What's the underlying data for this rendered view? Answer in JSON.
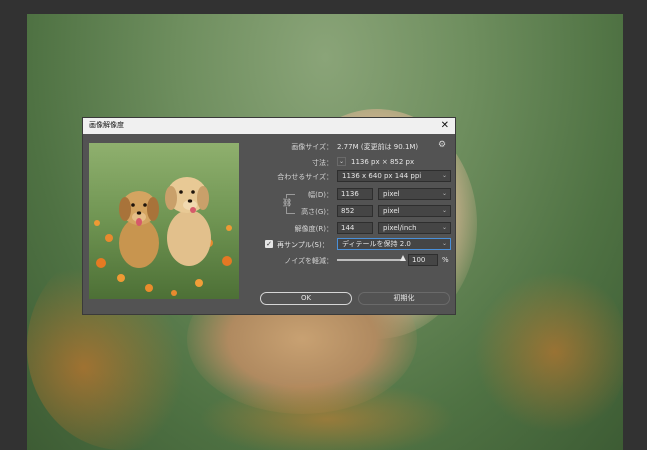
{
  "dialog": {
    "title": "画像解像度",
    "close_glyph": "✕",
    "image_size_label": "画像サイズ：",
    "image_size_value": "2.77M (変更前は 90.1M)",
    "dimensions_label": "寸法：",
    "dimensions_value": "1136 px × 852 px",
    "fit_label": "合わせるサイズ：",
    "fit_value": "1136 x 640 px 144 ppi",
    "width_label": "幅(D)：",
    "width_value": "1136",
    "width_unit": "pixel",
    "height_label": "高さ(G)：",
    "height_value": "852",
    "height_unit": "pixel",
    "resolution_label": "解像度(R)：",
    "resolution_value": "144",
    "resolution_unit": "pixel/inch",
    "resample_label": "再サンプル(S)：",
    "resample_value": "ディテールを保持 2.0",
    "resample_checked": true,
    "noise_label": "ノイズを軽減：",
    "noise_value": "100",
    "noise_unit": "%",
    "noise_level_percent": 100,
    "ok_label": "OK",
    "reset_label": "初期化"
  },
  "colors": {
    "app_bg": "#323232",
    "dialog_bg": "#535353",
    "titlebar_bg": "#f0f0f0",
    "accent": "#4a90d9"
  }
}
